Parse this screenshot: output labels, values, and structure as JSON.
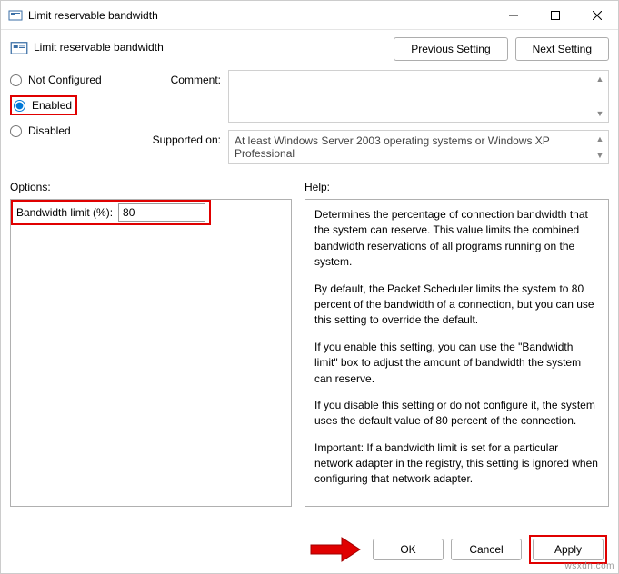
{
  "window": {
    "title": "Limit reservable bandwidth"
  },
  "header": {
    "title": "Limit reservable bandwidth",
    "prev": "Previous Setting",
    "next": "Next Setting"
  },
  "state": {
    "not_configured": "Not Configured",
    "enabled": "Enabled",
    "disabled": "Disabled",
    "selected": "enabled"
  },
  "fields": {
    "comment_label": "Comment:",
    "comment_value": "",
    "supported_label": "Supported on:",
    "supported_value": "At least Windows Server 2003 operating systems or Windows XP Professional"
  },
  "options": {
    "label": "Options:",
    "bandwidth_label": "Bandwidth limit (%):",
    "bandwidth_value": "80"
  },
  "help": {
    "label": "Help:",
    "p1": "Determines the percentage of connection bandwidth that the system can reserve. This value limits the combined bandwidth reservations of all programs running on the system.",
    "p2": "By default, the Packet Scheduler limits the system to 80 percent of the bandwidth of a connection, but you can use this setting to override the default.",
    "p3": "If you enable this setting, you can use the \"Bandwidth limit\" box to adjust the amount of bandwidth the system can reserve.",
    "p4": "If you disable this setting or do not configure it, the system uses the default value of 80 percent of the connection.",
    "p5": "Important: If a bandwidth limit is set for a particular network adapter in the registry, this setting is ignored when configuring that network adapter."
  },
  "footer": {
    "ok": "OK",
    "cancel": "Cancel",
    "apply": "Apply"
  },
  "watermark": "wsxdn.com"
}
